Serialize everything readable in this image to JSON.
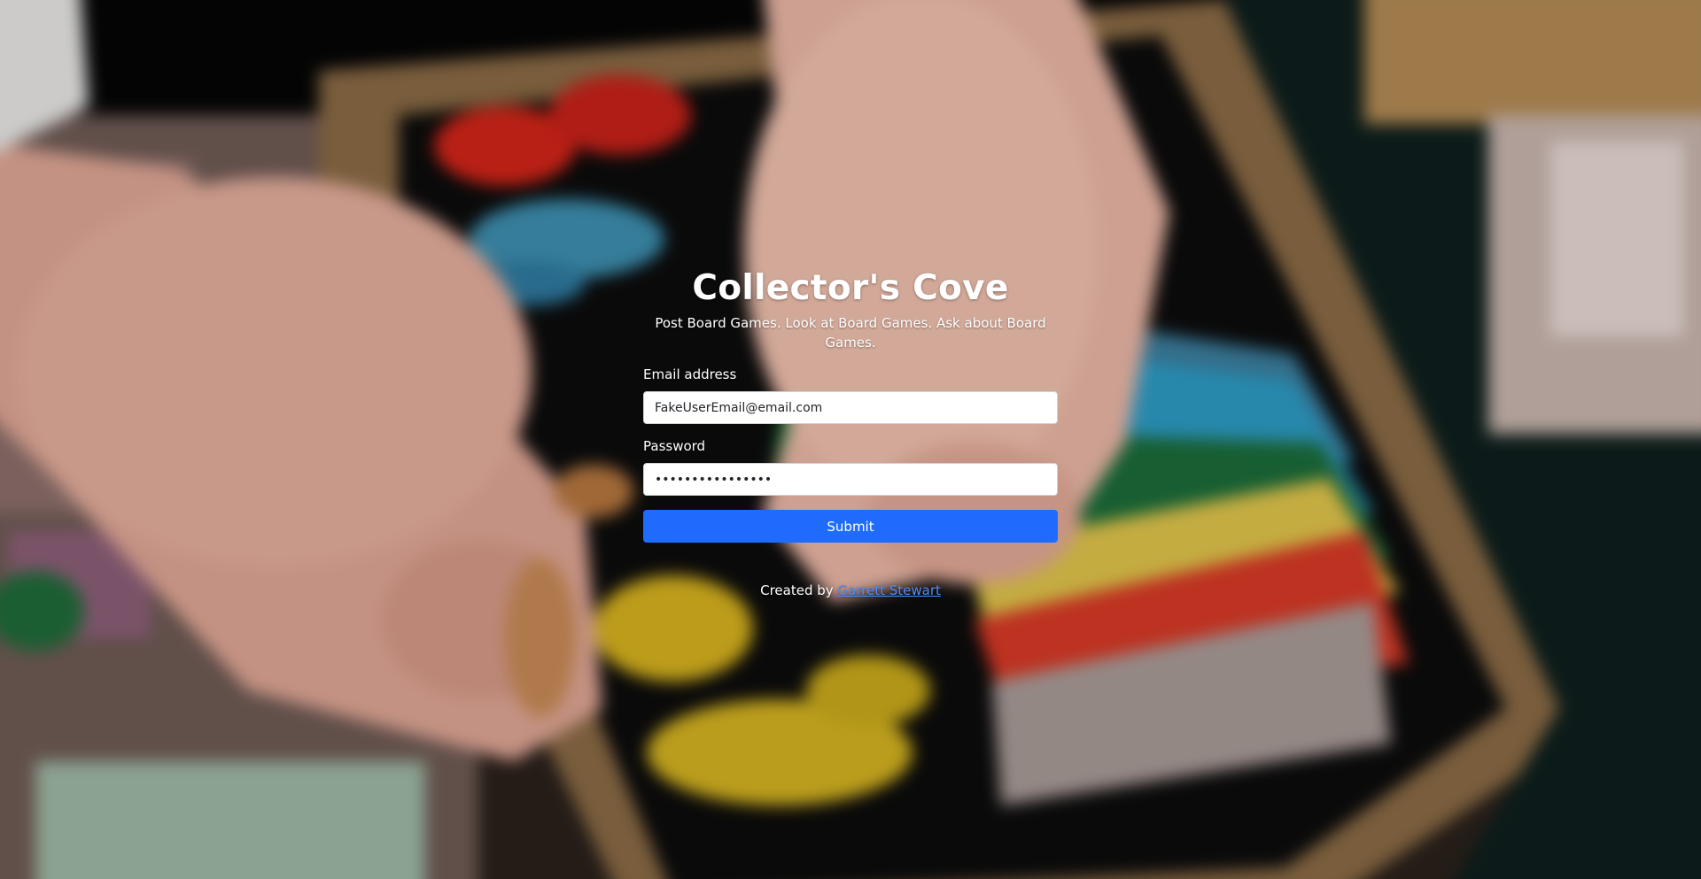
{
  "app": {
    "title": "Collector's Cove",
    "tagline": "Post Board Games. Look at Board Games. Ask about Board Games."
  },
  "form": {
    "email_label": "Email address",
    "email_value": "FakeUserEmail@email.com",
    "password_label": "Password",
    "password_value": "FakePassword1234",
    "submit_label": "Submit"
  },
  "footer": {
    "credit_prefix": "Created by",
    "author_link": "Garrett Stewart"
  },
  "colors": {
    "submit_button": "#1f6cfc",
    "link": "#4f8cf6",
    "text": "#ffffff"
  }
}
